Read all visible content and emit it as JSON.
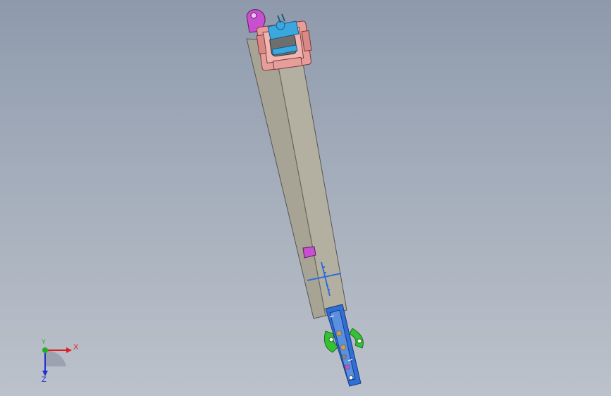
{
  "viewport": {
    "background_top": "#8e9aac",
    "background_bottom": "#bcc2cb"
  },
  "model": {
    "colors": {
      "beam": "#a8a495",
      "beam_dark": "#8f8b7d",
      "bracket": "#c84fd0",
      "clamp": "#e79e9b",
      "roller": "#3aa7df",
      "guide": "#2f6fd6",
      "wheel": "#34c234"
    }
  },
  "triad": {
    "x_label": "X",
    "y_label": "Y",
    "z_label": "Z",
    "x_color": "#e02020",
    "y_color": "#20b020",
    "z_color": "#2030d0"
  }
}
